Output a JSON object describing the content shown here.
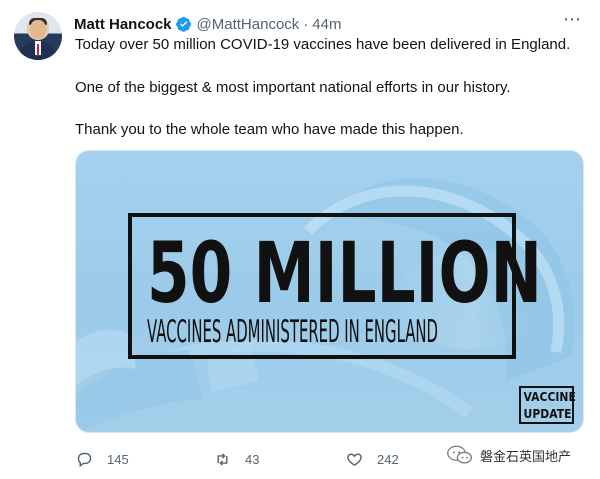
{
  "author": {
    "name": "Matt Hancock",
    "handle": "@MattHancock",
    "separator": "·",
    "time": "44m",
    "verified": true
  },
  "tweet": {
    "paragraphs": [
      "Today over 50 million COVID-19 vaccines have been delivered in England.",
      "One of the biggest & most important national efforts in our history.",
      "Thank you to the whole team who have made this happen."
    ]
  },
  "media": {
    "headline": "50 MILLION",
    "subheadline": "VACCINES ADMINISTERED IN ENGLAND",
    "badge_line1": "VACCINE",
    "badge_line2": "UPDATE"
  },
  "actions": {
    "replies": "145",
    "retweets": "43",
    "likes": "242"
  },
  "watermark": {
    "text": "磐金石英国地产"
  },
  "colors": {
    "verified_blue": "#1d9bf0",
    "secondary_text": "#536471",
    "media_blue": "#9ccce9"
  },
  "icons": {
    "more": "more-icon",
    "reply": "reply-icon",
    "retweet": "retweet-icon",
    "like": "heart-icon",
    "verified": "verified-badge-icon",
    "watermark": "wechat-icon"
  }
}
